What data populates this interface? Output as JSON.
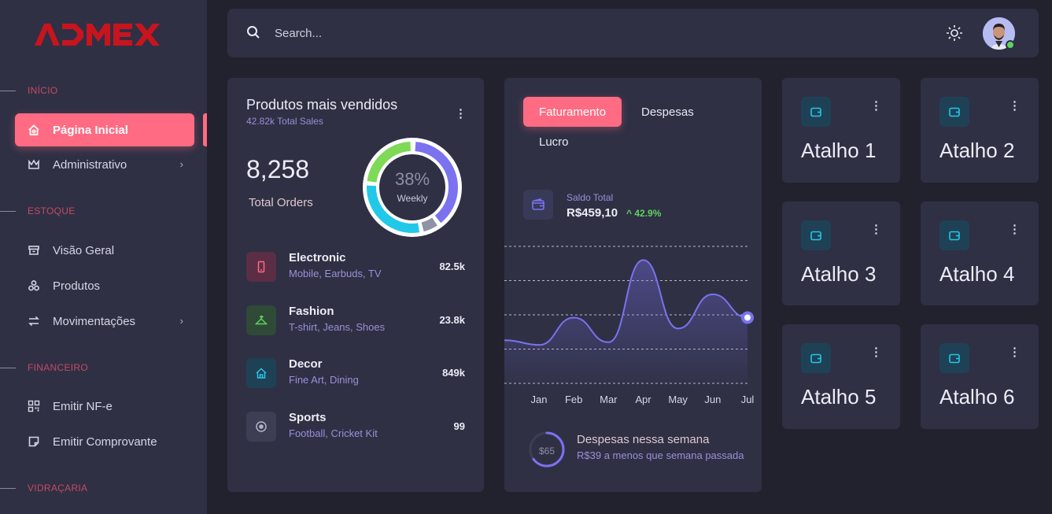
{
  "brand": {
    "logo_text": "ADMEX",
    "logo_color": "#c8141e"
  },
  "sidebar": {
    "sections": [
      {
        "label": "INÍCIO"
      },
      {
        "label": "ESTOQUE"
      },
      {
        "label": "FINANCEIRO"
      },
      {
        "label": "VIDRAÇARIA"
      }
    ],
    "items": [
      {
        "label": "Página Inicial",
        "icon": "home-icon",
        "active": true
      },
      {
        "label": "Administrativo",
        "icon": "crown-icon",
        "has_submenu": true
      },
      {
        "label": "Visão Geral",
        "icon": "archive-icon"
      },
      {
        "label": "Produtos",
        "icon": "boxes-icon"
      },
      {
        "label": "Movimentações",
        "icon": "transfer-icon",
        "has_submenu": true
      },
      {
        "label": "Emitir NF-e",
        "icon": "qrcode-icon"
      },
      {
        "label": "Emitir Comprovante",
        "icon": "sticky-note-icon"
      }
    ]
  },
  "topbar": {
    "search_placeholder": "Search..."
  },
  "best_sellers": {
    "title": "Produtos mais vendidos",
    "subtitle": "42.82k Total Sales",
    "total_orders": "8,258",
    "total_orders_label": "Total Orders",
    "donut_percent": "38%",
    "donut_label": "Weekly",
    "products": [
      {
        "name": "Electronic",
        "desc": "Mobile, Earbuds, TV",
        "value": "82.5k",
        "icon": "mobile-icon",
        "color": "#ff6b82"
      },
      {
        "name": "Fashion",
        "desc": "T-shirt, Jeans, Shoes",
        "value": "23.8k",
        "icon": "hanger-icon",
        "color": "#5fd35f"
      },
      {
        "name": "Decor",
        "desc": "Fine Art, Dining",
        "value": "849k",
        "icon": "house-icon",
        "color": "#22c8e8"
      },
      {
        "name": "Sports",
        "desc": "Football, Cricket Kit",
        "value": "99",
        "icon": "ball-icon",
        "color": "#9696ae"
      }
    ]
  },
  "revenue": {
    "tabs": [
      {
        "label": "Faturamento",
        "active": true
      },
      {
        "label": "Despesas"
      },
      {
        "label": "Lucro"
      }
    ],
    "saldo_label": "Saldo Total",
    "saldo_value": "R$459,10",
    "saldo_growth": "42.9%",
    "expense_amount": "$65",
    "expense_title": "Despesas nessa semana",
    "expense_sub": "R$39 a menos que semana passada",
    "expense_progress": 0.65
  },
  "chart_data": {
    "type": "area",
    "categories": [
      "Jan",
      "Feb",
      "Mar",
      "Apr",
      "May",
      "Jun",
      "Jul"
    ],
    "series": [
      {
        "values": [
          28,
          48,
          30,
          90,
          40,
          65,
          48
        ]
      }
    ],
    "ylim": [
      0,
      100
    ],
    "grid": true,
    "line_color": "#7b72f0"
  },
  "shortcuts": [
    {
      "label": "Atalho 1",
      "icon": "wallet-icon"
    },
    {
      "label": "Atalho 2",
      "icon": "wallet-icon"
    },
    {
      "label": "Atalho 3",
      "icon": "wallet-icon"
    },
    {
      "label": "Atalho 4",
      "icon": "wallet-icon"
    },
    {
      "label": "Atalho 5",
      "icon": "wallet-icon"
    },
    {
      "label": "Atalho 6",
      "icon": "wallet-icon"
    }
  ],
  "colors": {
    "accent": "#ff6b82",
    "panel": "#2f3044",
    "background": "#22222f",
    "violet": "#7b72f0",
    "green": "#5fd35f",
    "cyan": "#22c8e8"
  }
}
